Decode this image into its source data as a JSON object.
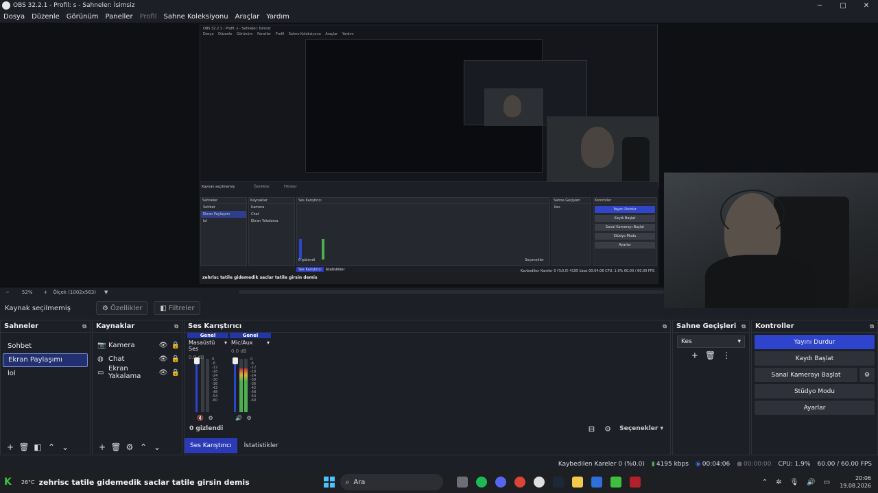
{
  "window": {
    "title": "OBS 32.2.1 - Profil: s - Sahneler: İsimsiz",
    "minimize": "─",
    "maximize": "□",
    "close": "✕"
  },
  "menu": [
    "Dosya",
    "Düzenle",
    "Görünüm",
    "Paneller",
    "Profil",
    "Sahne Koleksiyonu",
    "Araçlar",
    "Yardım"
  ],
  "preview": {
    "zoom": "52%",
    "scale_label": "Ölçek (1002x563)",
    "zoom_minus": "−",
    "zoom_plus": "+",
    "inner_title": "OBS 32.2.1 - Profil: s - Sahneler: İsimsiz",
    "inner_menu": [
      "Dosya",
      "Düzenle",
      "Görünüm",
      "Paneller",
      "Profil",
      "Sahne Koleksiyonu",
      "Araçlar",
      "Yardım"
    ],
    "inner_source_label": "Kaynak seçilmemiş",
    "inner_props": "Özellikler",
    "inner_filters": "Filtreler",
    "inner_scenes_title": "Sahneler",
    "inner_sources_title": "Kaynaklar",
    "inner_mixer_title": "Ses Karıştırıcı",
    "inner_trans_title": "Sahne Geçişleri",
    "inner_controls_title": "Kontroller",
    "inner_scenes": [
      "Sohbet",
      "Ekran Paylaşımı",
      "lol"
    ],
    "inner_sources": [
      "Kamera",
      "Chat",
      "Ekran Yakalama"
    ],
    "inner_controls": [
      "Yayını Durdur",
      "Kaydı Başlat",
      "Sanal Kamerayı Başlat",
      "Stüdyo Modu",
      "Ayarlar"
    ],
    "inner_trans": "Kes",
    "inner_ticker": "zehrisc tatile gidemedik saclar tatile girsin demis",
    "inner_status": "Kaybedilen Kareler 0 (%0.0)   4195 kbps   00:04:06   CPU: 1.9%   60.00 / 60.00 FPS",
    "inner_hidden": "0 gizlendi",
    "inner_tab1": "Ses Karıştırıcı",
    "inner_tab2": "İstatistikler",
    "inner_options": "Seçenekler"
  },
  "source_toolbar": {
    "no_source": "Kaynak seçilmemiş",
    "properties": "Özellikler",
    "filters": "Filtreler",
    "properties_icon": "gear-icon",
    "filters_icon": "filter-icon"
  },
  "scenes": {
    "title": "Sahneler",
    "items": [
      "Sohbet",
      "Ekran Paylaşımı",
      "lol"
    ],
    "selected": 1
  },
  "sources": {
    "title": "Kaynaklar",
    "items": [
      {
        "label": "Kamera",
        "icon": "camera-icon"
      },
      {
        "label": "Chat",
        "icon": "browser-icon"
      },
      {
        "label": "Ekran Yakalama",
        "icon": "monitor-icon"
      }
    ]
  },
  "mixer": {
    "title": "Ses Karıştırıcı",
    "channels": [
      {
        "header": "Genel",
        "name": "Masaüstü Ses",
        "db": "0.0 dB",
        "muted": true,
        "level": 0.0
      },
      {
        "header": "Genel",
        "name": "Mic/Aux",
        "db": "0.0 dB",
        "muted": false,
        "level": 0.82
      }
    ],
    "ticks": [
      "0",
      "-6",
      "-12",
      "-18",
      "-24",
      "-30",
      "-36",
      "-42",
      "-48",
      "-54",
      "-60"
    ],
    "hidden": "0 gizlendi",
    "options": "Seçenekler",
    "tab_mixer": "Ses Karıştırıcı",
    "tab_stats": "İstatistikler"
  },
  "transitions": {
    "title": "Sahne Geçişleri",
    "selected": "Kes"
  },
  "controls": {
    "title": "Kontroller",
    "stop_stream": "Yayını Durdur",
    "start_record": "Kaydı Başlat",
    "start_virtualcam": "Sanal Kamerayı Başlat",
    "studio_mode": "Stüdyo Modu",
    "settings": "Ayarlar"
  },
  "status": {
    "dropped": "Kaybedilen Kareler 0 (%0.0)",
    "bitrate": "4195 kbps",
    "stream_time": "00:04:06",
    "record_time": "00:00:00",
    "cpu": "CPU: 1.9%",
    "fps": "60.00 / 60.00 FPS"
  },
  "taskbar": {
    "temperature": "26°C",
    "ticker": "zehrisc tatile gidemedik saclar tatile girsin demis",
    "search": "Ara",
    "time": "20:06",
    "date": "19.08.2026",
    "colors": {
      "accent": "#2e44cc",
      "spotify": "#1db954"
    }
  }
}
